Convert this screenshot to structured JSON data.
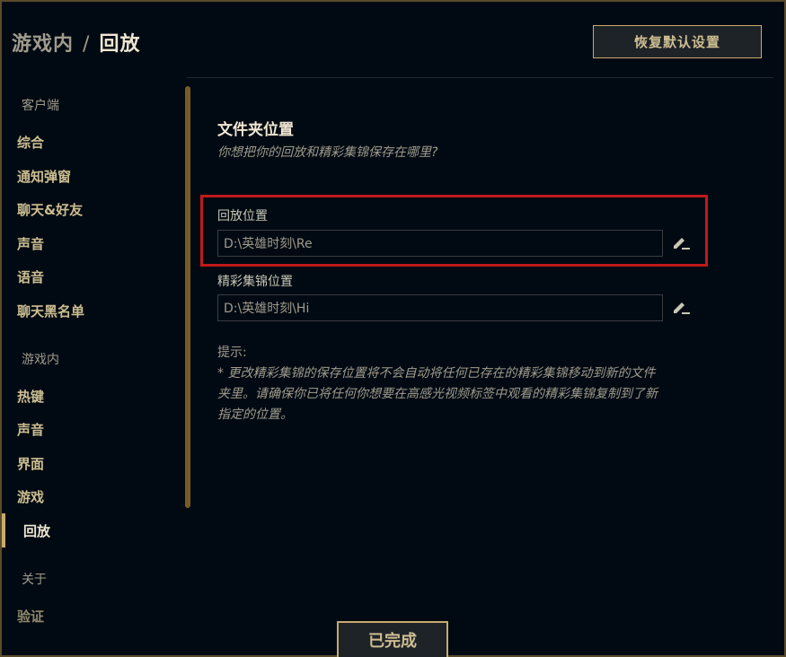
{
  "header": {
    "parent": "游戏内",
    "separator": "/",
    "current": "回放",
    "reset_label": "恢复默认设置"
  },
  "sidebar": {
    "client_head": "客户端",
    "client_items": [
      "综合",
      "通知弹窗",
      "聊天&好友",
      "声音",
      "语音",
      "聊天黑名单"
    ],
    "ingame_head": "游戏内",
    "ingame_items": [
      "热键",
      "声音",
      "界面",
      "游戏",
      "回放"
    ],
    "about_head": "关于",
    "about_items": [
      "验证"
    ],
    "active_item": "回放"
  },
  "main": {
    "section_title": "文件夹位置",
    "section_subtitle": "你想把你的回放和精彩集锦保存在哪里?",
    "replay_label": "回放位置",
    "replay_path": "D:\\英雄时刻\\Re",
    "highlights_label": "精彩集锦位置",
    "highlights_path": "D:\\英雄时刻\\Hi",
    "hint_head": "提示:",
    "hint_body": "* 更改精彩集锦的保存位置将不会自动将任何已存在的精彩集锦移动到新的文件夹里。请确保你已将任何你想要在高感光视频标签中观看的精彩集锦复制到了新指定的位置。"
  },
  "footer": {
    "done_label": "已完成"
  },
  "colors": {
    "background": "#010a13",
    "gold": "#c8aa6e",
    "highlight_box": "#c01a1a"
  }
}
